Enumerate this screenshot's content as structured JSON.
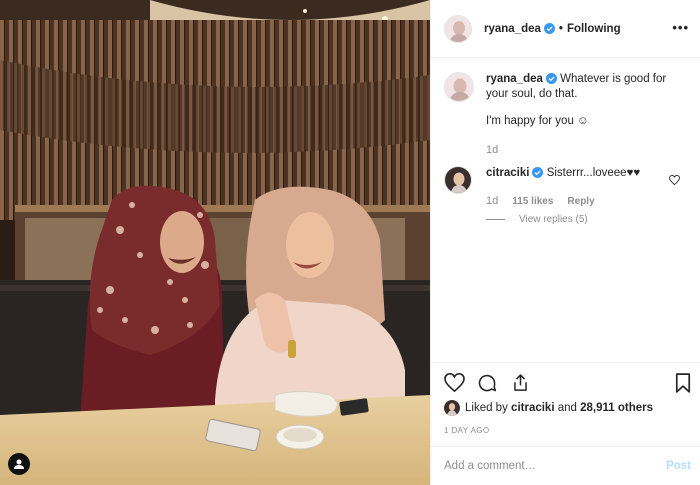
{
  "post": {
    "username": "ryana_dea",
    "follow_status": "Following",
    "more_label": "•••",
    "photo_alt": "Two women in hijabs laughing at a restaurant table"
  },
  "caption": {
    "username": "ryana_dea",
    "text": "Whatever is good for your soul, do that.",
    "text2": "I'm happy for you ☺",
    "time": "1d"
  },
  "comments": [
    {
      "username": "citraciki",
      "text": "Sisterrr...loveee♥♥",
      "time": "1d",
      "likes": "115 likes",
      "reply_label": "Reply",
      "view_replies": "View replies (5)"
    }
  ],
  "likes": {
    "prefix": "Liked by",
    "user": "citraciki",
    "conj": "and",
    "others": "28,911 others"
  },
  "post_date": "1 DAY AGO",
  "comment_box": {
    "placeholder": "Add a comment…",
    "post_label": "Post"
  },
  "icons": {
    "verified": "verified-badge-icon",
    "heart": "heart-icon",
    "comment": "comment-icon",
    "share": "share-icon",
    "save": "bookmark-icon",
    "tag": "user-tag-icon"
  },
  "colors": {
    "verified": "#3897f0",
    "post_button": "#b2dffc",
    "muted": "#8e8e8e"
  }
}
